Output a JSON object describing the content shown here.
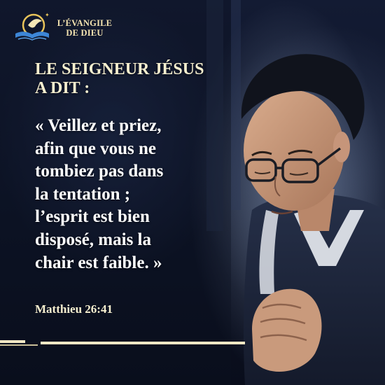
{
  "logo": {
    "line1": "L’ÉVANGILE",
    "line2": "DE DIEU"
  },
  "heading": {
    "line1": "LE SEIGNEUR JÉSUS",
    "line2": "A DIT :"
  },
  "quote": {
    "lines": [
      "« Veillez et priez,",
      "afin que vous ne",
      "tombiez pas dans",
      "la tentation ;",
      "l’esprit est bien",
      "disposé, mais la",
      "chair est faible. »"
    ]
  },
  "reference": "Matthieu 26:41",
  "colors": {
    "background": "#0e1529",
    "accent": "#f1e7c4",
    "logo_gold": "#e8c35a",
    "logo_blue": "#3d86d6"
  }
}
